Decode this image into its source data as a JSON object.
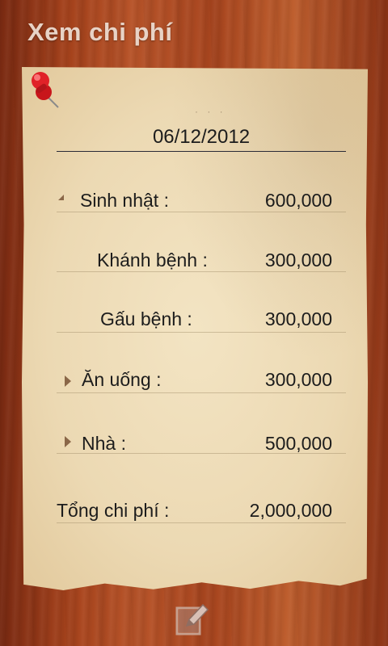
{
  "header": {
    "title": "Xem chi phí"
  },
  "paper": {
    "date": "06/12/2012",
    "rows": [
      {
        "label": "Sinh nhật :",
        "amount": "600,000",
        "expander": "expanded-triangle-icon"
      },
      {
        "label": "Khánh bệnh :",
        "amount": "300,000"
      },
      {
        "label": "Gấu bệnh :",
        "amount": "300,000"
      },
      {
        "label": "Ăn uống :",
        "amount": "300,000",
        "expander": "collapsed-triangle-icon"
      },
      {
        "label": "Nhà :",
        "amount": "500,000",
        "expander": "collapsed-triangle-icon"
      }
    ],
    "total": {
      "label": "Tổng chi phí :",
      "amount": "2,000,000"
    }
  },
  "icons": {
    "pin": "push-pin-icon",
    "edit": "edit-icon"
  },
  "colors": {
    "background_wood": "#a8441d",
    "paper": "#ecd9b3",
    "title_text": "#e8d3c6",
    "text": "#1c1c1c",
    "triangle": "#8a6748"
  }
}
